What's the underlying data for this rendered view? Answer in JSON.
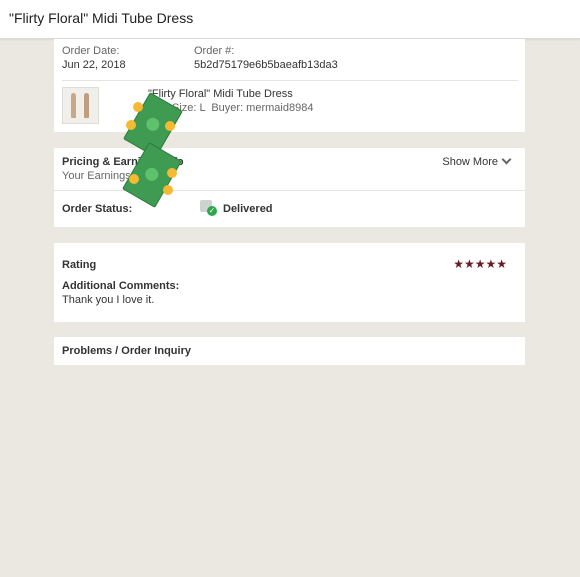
{
  "header": {
    "title": "\"Flirty Floral\" Midi Tube Dress"
  },
  "order": {
    "date_label": "Order Date:",
    "date_value": "Jun 22, 2018",
    "number_label": "Order #:",
    "number_value": "5b2d75179e6b5baeafb13da3",
    "item_title": "\"Flirty Floral\" Midi Tube Dress",
    "item_meta": "Size: L  Buyer: mermaid8984"
  },
  "pricing": {
    "title": "Pricing & Earnings Info",
    "earnings_label": "Your Earnings:",
    "show_more": "Show More"
  },
  "status": {
    "label": "Order Status:",
    "value": "Delivered"
  },
  "rating": {
    "title": "Rating",
    "stars": 5,
    "star_glyph": "★★★★★",
    "comments_label": "Additional Comments:",
    "comments_value": "Thank you I love it."
  },
  "problems": {
    "label": "Problems / Order Inquiry"
  },
  "colors": {
    "star": "#6a1b23",
    "money_green": "#3f9a52",
    "coin_gold": "#f5b932",
    "delivered_check": "#2aa84a"
  }
}
